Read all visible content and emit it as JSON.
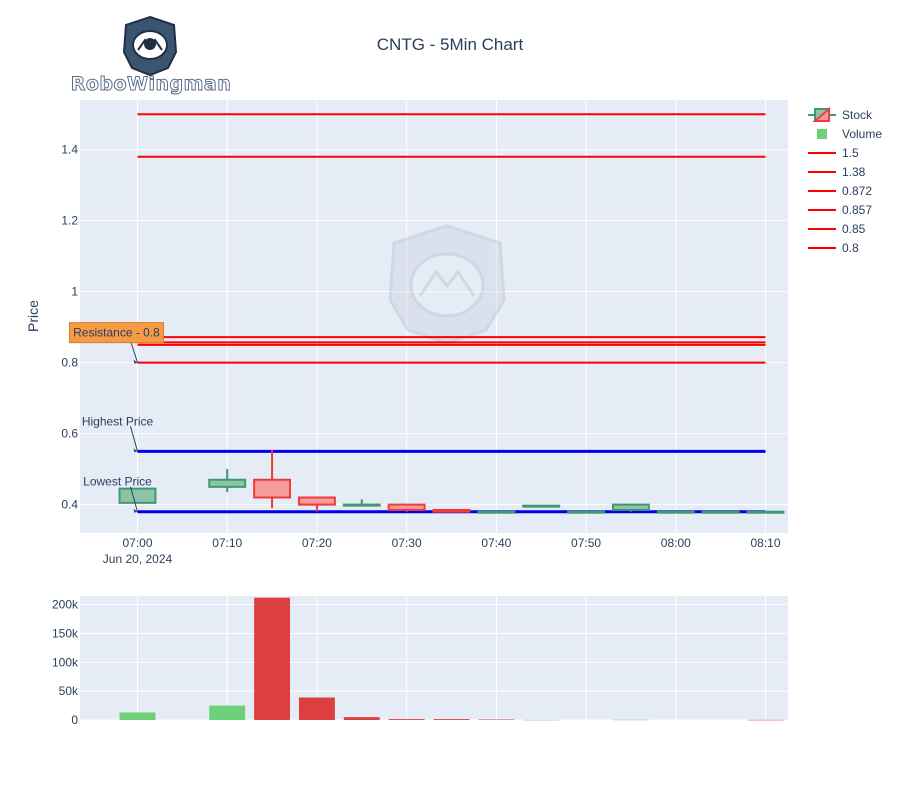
{
  "logo": {
    "text": "RoboWingman"
  },
  "colors": {
    "plot_bg": "#e5ecf6",
    "grid": "#ffffff",
    "up": "#3d9970",
    "up_fill": "#8fc3a8",
    "down": "#ef3b3b",
    "down_fill": "#f79a9a",
    "vol_up": "#6fd07a",
    "vol_down": "#dd3e3e",
    "resistance": "#ff0000",
    "support": "#0000ee",
    "annot_box": "#f59b45"
  },
  "chart_data": [
    {
      "type": "candlestick",
      "title": "CNTG - 5Min Chart",
      "ylabel": "Price",
      "ylim": [
        0.32,
        1.54
      ],
      "yticks": [
        0.4,
        0.6,
        0.8,
        1,
        1.2,
        1.4
      ],
      "ytick_labels": [
        "0.4",
        "0.6",
        "0.8",
        "1",
        "1.2",
        "1.4"
      ],
      "xrange": [
        "07:00",
        "08:12"
      ],
      "xticks": [
        "07:00",
        "07:10",
        "07:20",
        "07:30",
        "07:40",
        "07:50",
        "08:00",
        "08:10"
      ],
      "xtick_labels": [
        "07:00",
        "07:10",
        "07:20",
        "07:30",
        "07:40",
        "07:50",
        "08:00",
        "08:10"
      ],
      "xtick_sublabel": "Jun 20, 2024",
      "candles": [
        {
          "time": "07:00",
          "open": 0.405,
          "high": 0.445,
          "low": 0.405,
          "close": 0.445
        },
        {
          "time": "07:10",
          "open": 0.45,
          "high": 0.5,
          "low": 0.435,
          "close": 0.47
        },
        {
          "time": "07:15",
          "open": 0.47,
          "high": 0.555,
          "low": 0.39,
          "close": 0.42
        },
        {
          "time": "07:20",
          "open": 0.42,
          "high": 0.42,
          "low": 0.38,
          "close": 0.4
        },
        {
          "time": "07:25",
          "open": 0.4,
          "high": 0.415,
          "low": 0.4,
          "close": 0.4
        },
        {
          "time": "07:30",
          "open": 0.4,
          "high": 0.4,
          "low": 0.38,
          "close": 0.385
        },
        {
          "time": "07:35",
          "open": 0.385,
          "high": 0.385,
          "low": 0.38,
          "close": 0.38
        },
        {
          "time": "07:40",
          "open": 0.38,
          "high": 0.38,
          "low": 0.38,
          "close": 0.38
        },
        {
          "time": "07:45",
          "open": 0.395,
          "high": 0.395,
          "low": 0.395,
          "close": 0.397
        },
        {
          "time": "07:50",
          "open": 0.38,
          "high": 0.38,
          "low": 0.38,
          "close": 0.38
        },
        {
          "time": "07:55",
          "open": 0.385,
          "high": 0.4,
          "low": 0.38,
          "close": 0.4
        },
        {
          "time": "08:00",
          "open": 0.38,
          "high": 0.38,
          "low": 0.38,
          "close": 0.38
        },
        {
          "time": "08:05",
          "open": 0.38,
          "high": 0.38,
          "low": 0.38,
          "close": 0.38
        },
        {
          "time": "08:10",
          "open": 0.38,
          "high": 0.38,
          "low": 0.38,
          "close": 0.38
        }
      ],
      "resistance_lines": [
        1.5,
        1.38,
        0.872,
        0.857,
        0.85,
        0.8
      ],
      "support_lines": [
        0.55,
        0.38
      ],
      "lines_x": [
        "07:00",
        "08:10"
      ],
      "legend": [
        "Stock",
        "Volume",
        "1.5",
        "1.38",
        "0.872",
        "0.857",
        "0.85",
        "0.8"
      ],
      "annotations": [
        {
          "text": "Resistance - 0.8",
          "x": "07:00",
          "y": 0.8,
          "boxed": true
        },
        {
          "text": "Highest Price",
          "x": "07:00",
          "y": 0.55,
          "boxed": false
        },
        {
          "text": "Lowest Price",
          "x": "07:00",
          "y": 0.38,
          "boxed": false
        }
      ]
    },
    {
      "type": "bar",
      "ylim": [
        0,
        215000
      ],
      "yticks": [
        0,
        50000,
        100000,
        150000,
        200000
      ],
      "ytick_labels": [
        "0",
        "50k",
        "100k",
        "150k",
        "200k"
      ],
      "bars": [
        {
          "time": "07:00",
          "value": 13000,
          "dir": "up"
        },
        {
          "time": "07:10",
          "value": 25000,
          "dir": "up"
        },
        {
          "time": "07:15",
          "value": 212000,
          "dir": "down"
        },
        {
          "time": "07:20",
          "value": 39000,
          "dir": "down"
        },
        {
          "time": "07:25",
          "value": 5000,
          "dir": "down"
        },
        {
          "time": "07:30",
          "value": 1500,
          "dir": "down"
        },
        {
          "time": "07:35",
          "value": 1500,
          "dir": "down"
        },
        {
          "time": "07:40",
          "value": 800,
          "dir": "down"
        },
        {
          "time": "07:45",
          "value": 300,
          "dir": "up"
        },
        {
          "time": "07:55",
          "value": 500,
          "dir": "up"
        },
        {
          "time": "08:10",
          "value": 300,
          "dir": "down"
        }
      ]
    }
  ]
}
